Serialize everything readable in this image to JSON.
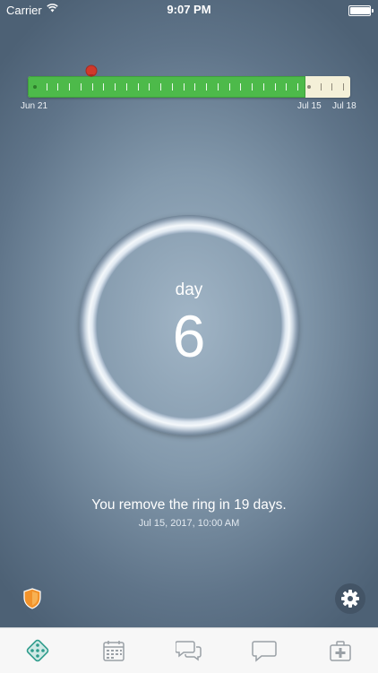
{
  "status_bar": {
    "carrier": "Carrier",
    "time": "9:07 PM"
  },
  "timeline": {
    "start_label": "Jun 21",
    "mid_label": "Jul 15",
    "end_label": "Jul 18",
    "colors": {
      "filled": "#4dba4a",
      "remaining": "#f4f0d8",
      "marker": "#d0392b"
    }
  },
  "ring": {
    "day_label": "day",
    "day_number": "6"
  },
  "info": {
    "message": "You remove the ring in 19 days.",
    "datetime": "Jul 15, 2017, 10:00 AM"
  },
  "icons": {
    "shield": "shield-icon",
    "settings": "gear-icon"
  },
  "tabbar": {
    "tabs": [
      {
        "icon": "pill-pack-icon",
        "active": true
      },
      {
        "icon": "calendar-icon",
        "active": false
      },
      {
        "icon": "chat-bubbles-icon",
        "active": false
      },
      {
        "icon": "speech-bubble-icon",
        "active": false
      },
      {
        "icon": "medical-kit-icon",
        "active": false
      }
    ]
  }
}
